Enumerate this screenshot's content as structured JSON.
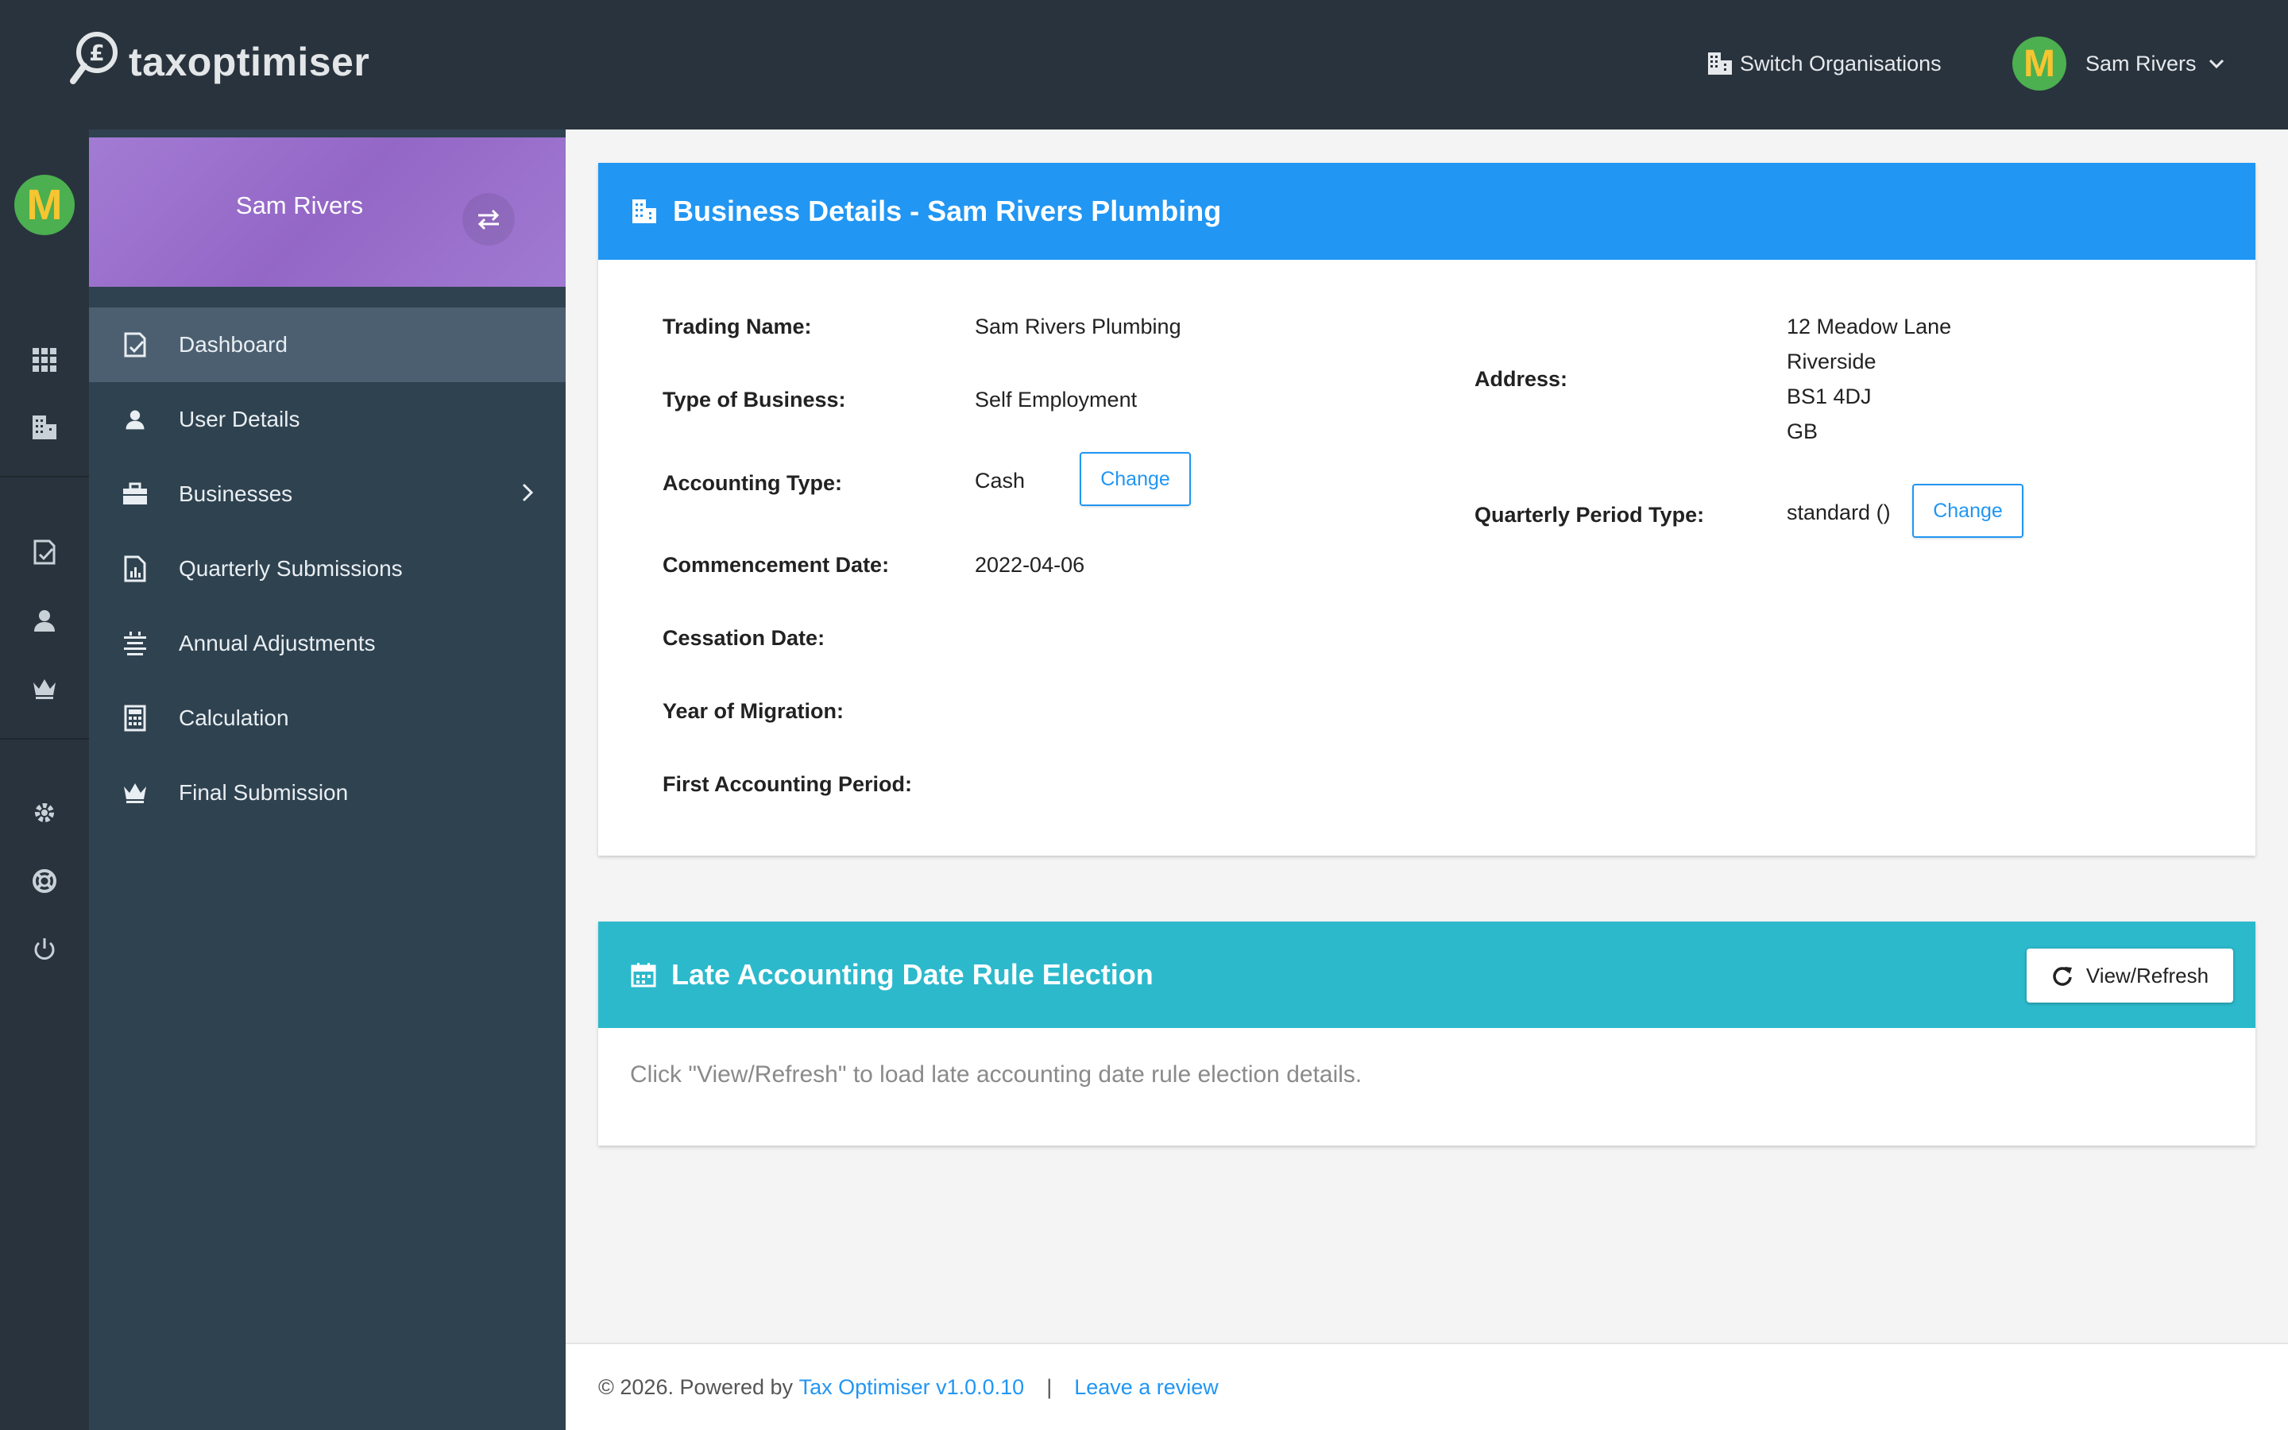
{
  "app": {
    "logo_text": "taxoptimiser"
  },
  "topbar": {
    "switch_org_label": "Switch Organisations",
    "user_initial": "M",
    "user_name": "Sam Rivers"
  },
  "rail": {
    "avatar_initial": "M"
  },
  "sidebar": {
    "profile_name": "Sam Rivers",
    "items": [
      {
        "label": "Dashboard",
        "icon": "dashboard-check-icon",
        "active": true
      },
      {
        "label": "User Details",
        "icon": "user-icon"
      },
      {
        "label": "Businesses",
        "icon": "briefcase-icon",
        "has_submenu": true
      },
      {
        "label": "Quarterly Submissions",
        "icon": "report-chart-icon"
      },
      {
        "label": "Annual Adjustments",
        "icon": "list-adjust-icon"
      },
      {
        "label": "Calculation",
        "icon": "calculator-icon"
      },
      {
        "label": "Final Submission",
        "icon": "crown-icon"
      }
    ]
  },
  "business_details": {
    "title": "Business Details - Sam Rivers Plumbing",
    "trading_name_label": "Trading Name:",
    "trading_name": "Sam Rivers Plumbing",
    "type_label": "Type of Business:",
    "type": "Self Employment",
    "accounting_type_label": "Accounting Type:",
    "accounting_type": "Cash",
    "change_label": "Change",
    "commencement_label": "Commencement Date:",
    "commencement": "2022-04-06",
    "cessation_label": "Cessation Date:",
    "migration_label": "Year of Migration:",
    "first_period_label": "First Accounting Period:",
    "address_label": "Address:",
    "address_lines": [
      "12 Meadow Lane",
      "Riverside",
      "BS1 4DJ",
      "GB"
    ],
    "quarterly_label": "Quarterly Period Type:",
    "quarterly": "standard ()",
    "quarterly_change_label": "Change"
  },
  "late_election": {
    "title": "Late Accounting Date Rule Election",
    "refresh_label": "View/Refresh",
    "hint": "Click \"View/Refresh\" to load late accounting date rule election details."
  },
  "footer": {
    "copyright": "© 2026. Powered by",
    "product_link": "Tax Optimiser v1.0.0.10",
    "separator": "|",
    "review_link": "Leave a review"
  },
  "colors": {
    "topbar": "#29333d",
    "sidebar": "#2f4250",
    "profile_card": "#9b6fcc",
    "primary": "#2196f3",
    "teal": "#2cb9cc"
  }
}
